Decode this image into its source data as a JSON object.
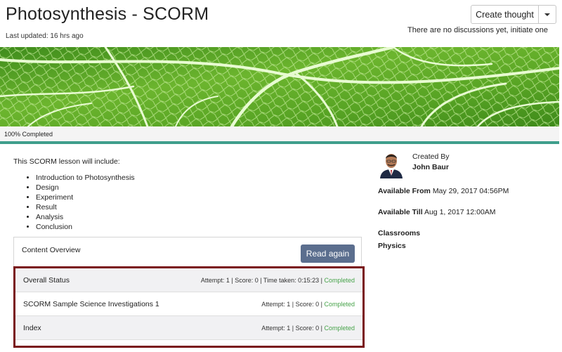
{
  "header": {
    "title": "Photosynthesis - SCORM",
    "last_updated": "Last updated: 16 hrs ago",
    "create_thought_label": "Create thought",
    "discussions_text": "There are no discussions yet, initiate one"
  },
  "progress": {
    "label": "100% Completed",
    "percent": 100
  },
  "lesson": {
    "intro": "This SCORM lesson will include:",
    "topics": [
      "Introduction to Photosynthesis",
      "Design",
      "Experiment",
      "Result",
      "Analysis",
      "Conclusion"
    ]
  },
  "content_overview": {
    "title": "Content Overview",
    "read_again_label": "Read again",
    "rows": [
      {
        "name": "Overall Status",
        "meta": "Attempt: 1 | Score: 0 | Time taken: 0:15:23 | ",
        "status": "Completed"
      },
      {
        "name": "SCORM Sample Science Investigations 1",
        "meta": "Attempt: 1 | Score: 0 | ",
        "status": "Completed"
      },
      {
        "name": "Index",
        "meta": "Attempt: 1 | Score: 0 | ",
        "status": "Completed"
      }
    ]
  },
  "sidebar": {
    "created_by_label": "Created By",
    "author": "John Baur",
    "available_from_label": "Available From",
    "available_from": "May 29, 2017 04:56PM",
    "available_till_label": "Available Till",
    "available_till": "Aug 1, 2017 12:00AM",
    "classrooms": "Classrooms",
    "subject": "Physics"
  },
  "colors": {
    "progress_fill": "#3f9e8c",
    "read_again_bg": "#5b6e8e",
    "completed_text": "#47a34a",
    "highlight_border": "#7a1519"
  }
}
